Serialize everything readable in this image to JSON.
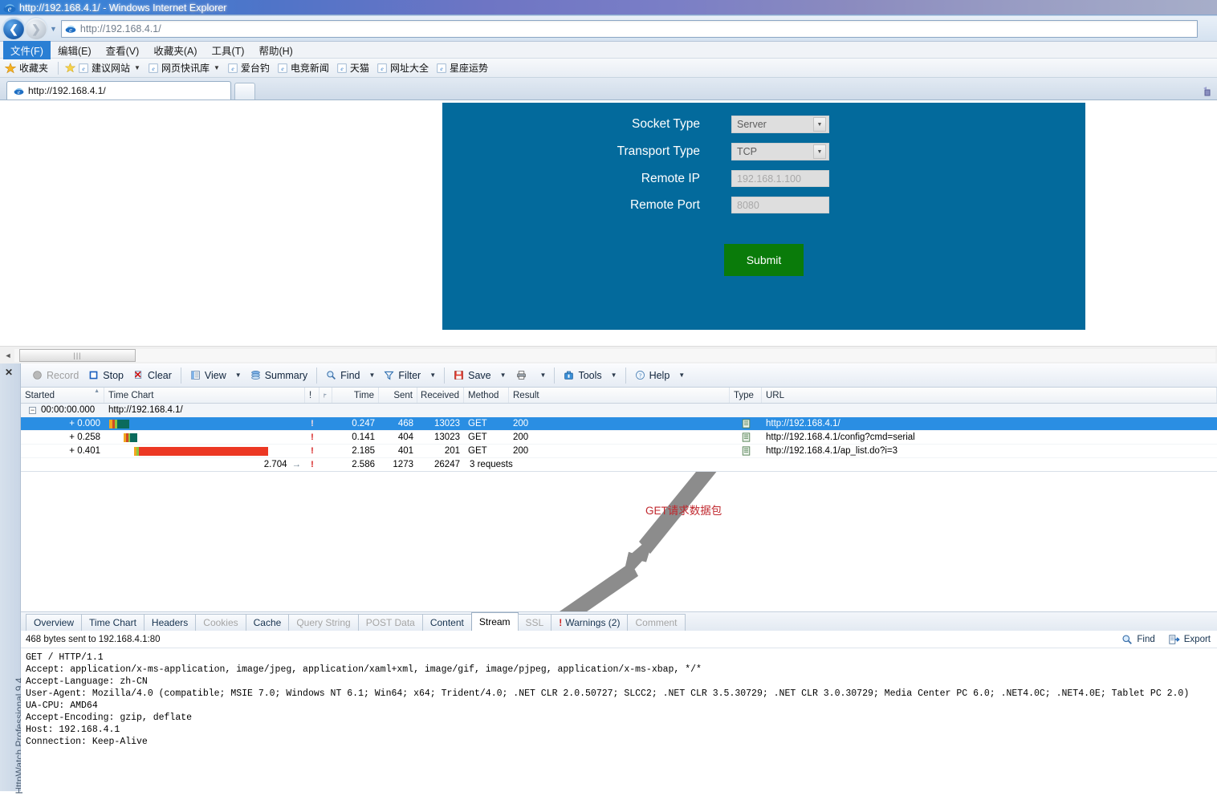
{
  "window": {
    "title": "http://192.168.4.1/ - Windows Internet Explorer",
    "icon": "ie-logo-icon"
  },
  "nav": {
    "back_icon": "back-arrow-icon",
    "forward_icon": "forward-arrow-icon",
    "history_caret": "▼",
    "address_value": "http://192.168.4.1/",
    "address_icon": "ie-logo-icon"
  },
  "menu": {
    "items": [
      {
        "label": "文件(F)",
        "selected": true
      },
      {
        "label": "编辑(E)",
        "selected": false
      },
      {
        "label": "查看(V)",
        "selected": false
      },
      {
        "label": "收藏夹(A)",
        "selected": false
      },
      {
        "label": "工具(T)",
        "selected": false
      },
      {
        "label": "帮助(H)",
        "selected": false
      }
    ]
  },
  "favorites": {
    "root_label": "收藏夹",
    "root_icon": "star-icon",
    "items": [
      {
        "label": "建议网站",
        "icon": "star-gold-icon",
        "has_caret": true,
        "second_icon": "ie-logo-icon"
      },
      {
        "label": "网页快讯库",
        "icon": "ie-logo-icon",
        "has_caret": true
      },
      {
        "label": "爱台钓",
        "icon": "ie-logo-icon",
        "has_caret": false
      },
      {
        "label": "电竞新闻",
        "icon": "ie-logo-icon",
        "has_caret": false
      },
      {
        "label": "天猫",
        "icon": "ie-logo-icon",
        "has_caret": false
      },
      {
        "label": "网址大全",
        "icon": "ie-logo-icon",
        "has_caret": false
      },
      {
        "label": "星座运势",
        "icon": "ie-logo-icon",
        "has_caret": false
      }
    ]
  },
  "tabstrip": {
    "tab_label": "http://192.168.4.1/",
    "tab_icon": "ie-logo-icon",
    "new_tab_name": "new-tab"
  },
  "page_form": {
    "panel_color": "#036a9c",
    "fields": [
      {
        "label": "Socket Type",
        "type": "select",
        "value": "Server",
        "name": "socket-type"
      },
      {
        "label": "Transport Type",
        "type": "select",
        "value": "TCP",
        "name": "transport-type"
      },
      {
        "label": "Remote IP",
        "type": "text",
        "value": "192.168.1.100",
        "name": "remote-ip"
      },
      {
        "label": "Remote Port",
        "type": "text",
        "value": "8080",
        "name": "remote-port"
      }
    ],
    "submit_label": "Submit",
    "submit_color": "#0a7b0a"
  },
  "page_scroll": {
    "left_arrow": "◄",
    "thumb_grip": "|||"
  },
  "httpwatch": {
    "product_label": "HttpWatch Professional 9.4",
    "close_label": "✕",
    "toolbar": [
      {
        "label": "Record",
        "icon": "record-circle-icon",
        "disabled": true,
        "caret": false
      },
      {
        "label": "Stop",
        "icon": "stop-square-icon",
        "disabled": false,
        "caret": false
      },
      {
        "label": "Clear",
        "icon": "clear-icon",
        "disabled": false,
        "caret": false
      },
      {
        "label": "View",
        "icon": "view-grid-icon",
        "disabled": false,
        "caret": true
      },
      {
        "label": "Summary",
        "icon": "summary-layers-icon",
        "disabled": false,
        "caret": false
      },
      {
        "label": "Find",
        "icon": "search-icon",
        "disabled": false,
        "caret": true
      },
      {
        "label": "Filter",
        "icon": "funnel-icon",
        "disabled": false,
        "caret": true
      },
      {
        "label": "Save",
        "icon": "save-disk-icon",
        "disabled": false,
        "caret": true
      },
      {
        "label": "",
        "icon": "printer-icon",
        "disabled": false,
        "caret": true
      },
      {
        "label": "Tools",
        "icon": "toolbox-icon",
        "disabled": false,
        "caret": true
      },
      {
        "label": "Help",
        "icon": "help-question-icon",
        "disabled": false,
        "caret": true
      }
    ],
    "grid": {
      "columns": [
        "Started",
        "Time Chart",
        "!",
        "⚑",
        "Time",
        "Sent",
        "Received",
        "Method",
        "Result",
        "Type",
        "URL"
      ],
      "parent_row": {
        "started": "00:00:00.000",
        "url": "http://192.168.4.1/"
      },
      "rows": [
        {
          "started": "+ 0.000",
          "warn": "!",
          "time": "0.247",
          "sent": "468",
          "received": "13023",
          "method": "GET",
          "result": "200",
          "url": "http://192.168.4.1/",
          "selected": true,
          "type_icon": "document-icon"
        },
        {
          "started": "+ 0.258",
          "warn": "!",
          "time": "0.141",
          "sent": "404",
          "received": "13023",
          "method": "GET",
          "result": "200",
          "url": "http://192.168.4.1/config?cmd=serial",
          "selected": false,
          "type_icon": "document-icon"
        },
        {
          "started": "+ 0.401",
          "warn": "!",
          "time": "2.185",
          "sent": "401",
          "received": "201",
          "method": "GET",
          "result": "200",
          "url": "http://192.168.4.1/ap_list.do?i=3",
          "selected": false,
          "type_icon": "document-icon"
        }
      ],
      "total_row": {
        "chart_total": "2.704",
        "warn": "!",
        "time": "2.586",
        "sent": "1273",
        "received": "26247",
        "method": "3 requests"
      }
    },
    "annotation": {
      "text": "GET请求数据包",
      "color": "#c0272d"
    },
    "bottom_tabs": [
      {
        "label": "Overview",
        "state": "normal"
      },
      {
        "label": "Time Chart",
        "state": "normal"
      },
      {
        "label": "Headers",
        "state": "normal"
      },
      {
        "label": "Cookies",
        "state": "disabled"
      },
      {
        "label": "Cache",
        "state": "normal"
      },
      {
        "label": "Query String",
        "state": "disabled"
      },
      {
        "label": "POST Data",
        "state": "disabled"
      },
      {
        "label": "Content",
        "state": "normal"
      },
      {
        "label": "Stream",
        "state": "active"
      },
      {
        "label": "SSL",
        "state": "disabled"
      },
      {
        "label": "Warnings (2)",
        "state": "warning",
        "badge": "!"
      },
      {
        "label": "Comment",
        "state": "disabled"
      }
    ],
    "stream_status": "468 bytes sent to 192.168.4.1:80",
    "stream_actions": [
      {
        "label": "Find",
        "icon": "search-icon"
      },
      {
        "label": "Export",
        "icon": "export-icon"
      }
    ],
    "stream_lines": [
      "GET / HTTP/1.1",
      "Accept: application/x-ms-application, image/jpeg, application/xaml+xml, image/gif, image/pjpeg, application/x-ms-xbap, */*",
      "Accept-Language: zh-CN",
      "User-Agent: Mozilla/4.0 (compatible; MSIE 7.0; Windows NT 6.1; Win64; x64; Trident/4.0; .NET CLR 2.0.50727; SLCC2; .NET CLR 3.5.30729; .NET CLR 3.0.30729; Media Center PC 6.0; .NET4.0C; .NET4.0E; Tablet PC 2.0)",
      "UA-CPU: AMD64",
      "Accept-Encoding: gzip, deflate",
      "Host: 192.168.4.1",
      "Connection: Keep-Alive"
    ]
  }
}
